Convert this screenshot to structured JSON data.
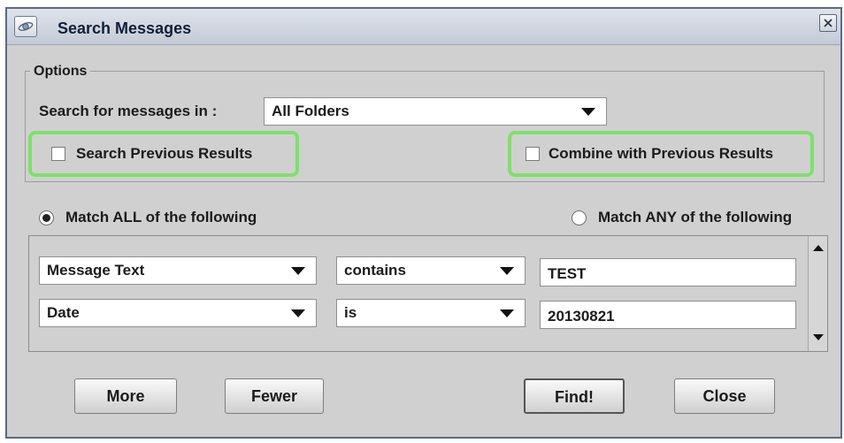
{
  "window": {
    "title": "Search Messages"
  },
  "options": {
    "legend": "Options",
    "search_in_label": "Search for messages in :",
    "folder_selected": "All Folders",
    "search_previous_label": "Search Previous Results",
    "search_previous_checked": false,
    "combine_previous_label": "Combine with Previous Results",
    "combine_previous_checked": false
  },
  "match": {
    "all_label": "Match ALL of the following",
    "any_label": "Match ANY of the following",
    "selected": "all"
  },
  "criteria": [
    {
      "field": "Message Text",
      "operator": "contains",
      "value": "TEST"
    },
    {
      "field": "Date",
      "operator": "is",
      "value": "20130821"
    }
  ],
  "buttons": {
    "more": "More",
    "fewer": "Fewer",
    "find": "Find!",
    "close": "Close"
  },
  "colors": {
    "highlight": "#7ee06b",
    "window_bg": "#d0d0d0"
  },
  "icons": {
    "app": "ringed-planet-icon",
    "close": "close-x-icon"
  }
}
